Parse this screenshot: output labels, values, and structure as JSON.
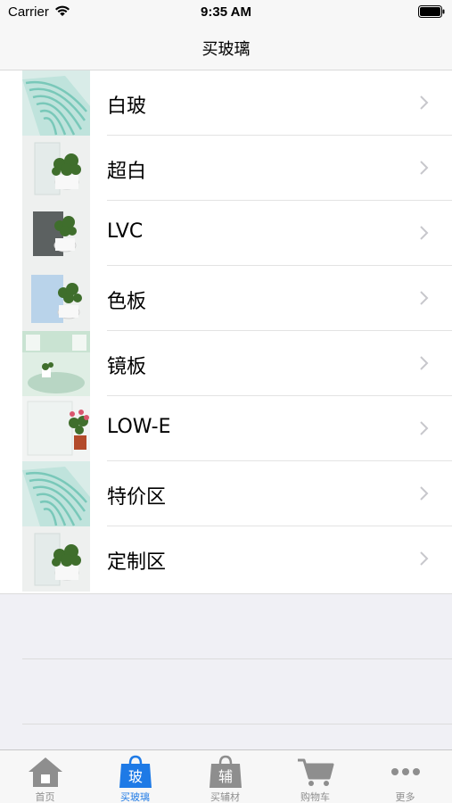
{
  "status_bar": {
    "carrier": "Carrier",
    "time": "9:35 AM"
  },
  "nav": {
    "title": "买玻璃"
  },
  "categories": [
    {
      "label": "白玻",
      "image": "glass-sheets"
    },
    {
      "label": "超白",
      "image": "plant-glass"
    },
    {
      "label": "LVC",
      "image": "grey-glass-plant"
    },
    {
      "label": "色板",
      "image": "blue-glass-plant"
    },
    {
      "label": "镜板",
      "image": "mirror-room"
    },
    {
      "label": "LOW-E",
      "image": "flower-glass"
    },
    {
      "label": "特价区",
      "image": "glass-sheets"
    },
    {
      "label": "定制区",
      "image": "plant-glass"
    }
  ],
  "tabs": [
    {
      "label": "首页",
      "icon": "home-icon",
      "active": false
    },
    {
      "label": "买玻璃",
      "icon": "shopping-bag-icon",
      "badge": "玻",
      "active": true
    },
    {
      "label": "买辅材",
      "icon": "shopping-bag-icon",
      "badge": "辅",
      "active": false
    },
    {
      "label": "购物车",
      "icon": "cart-icon",
      "active": false
    },
    {
      "label": "更多",
      "icon": "more-icon",
      "active": false
    }
  ],
  "colors": {
    "accent": "#1e7ae6",
    "inactive": "#8e8e8e",
    "background": "#f0f0f5"
  }
}
